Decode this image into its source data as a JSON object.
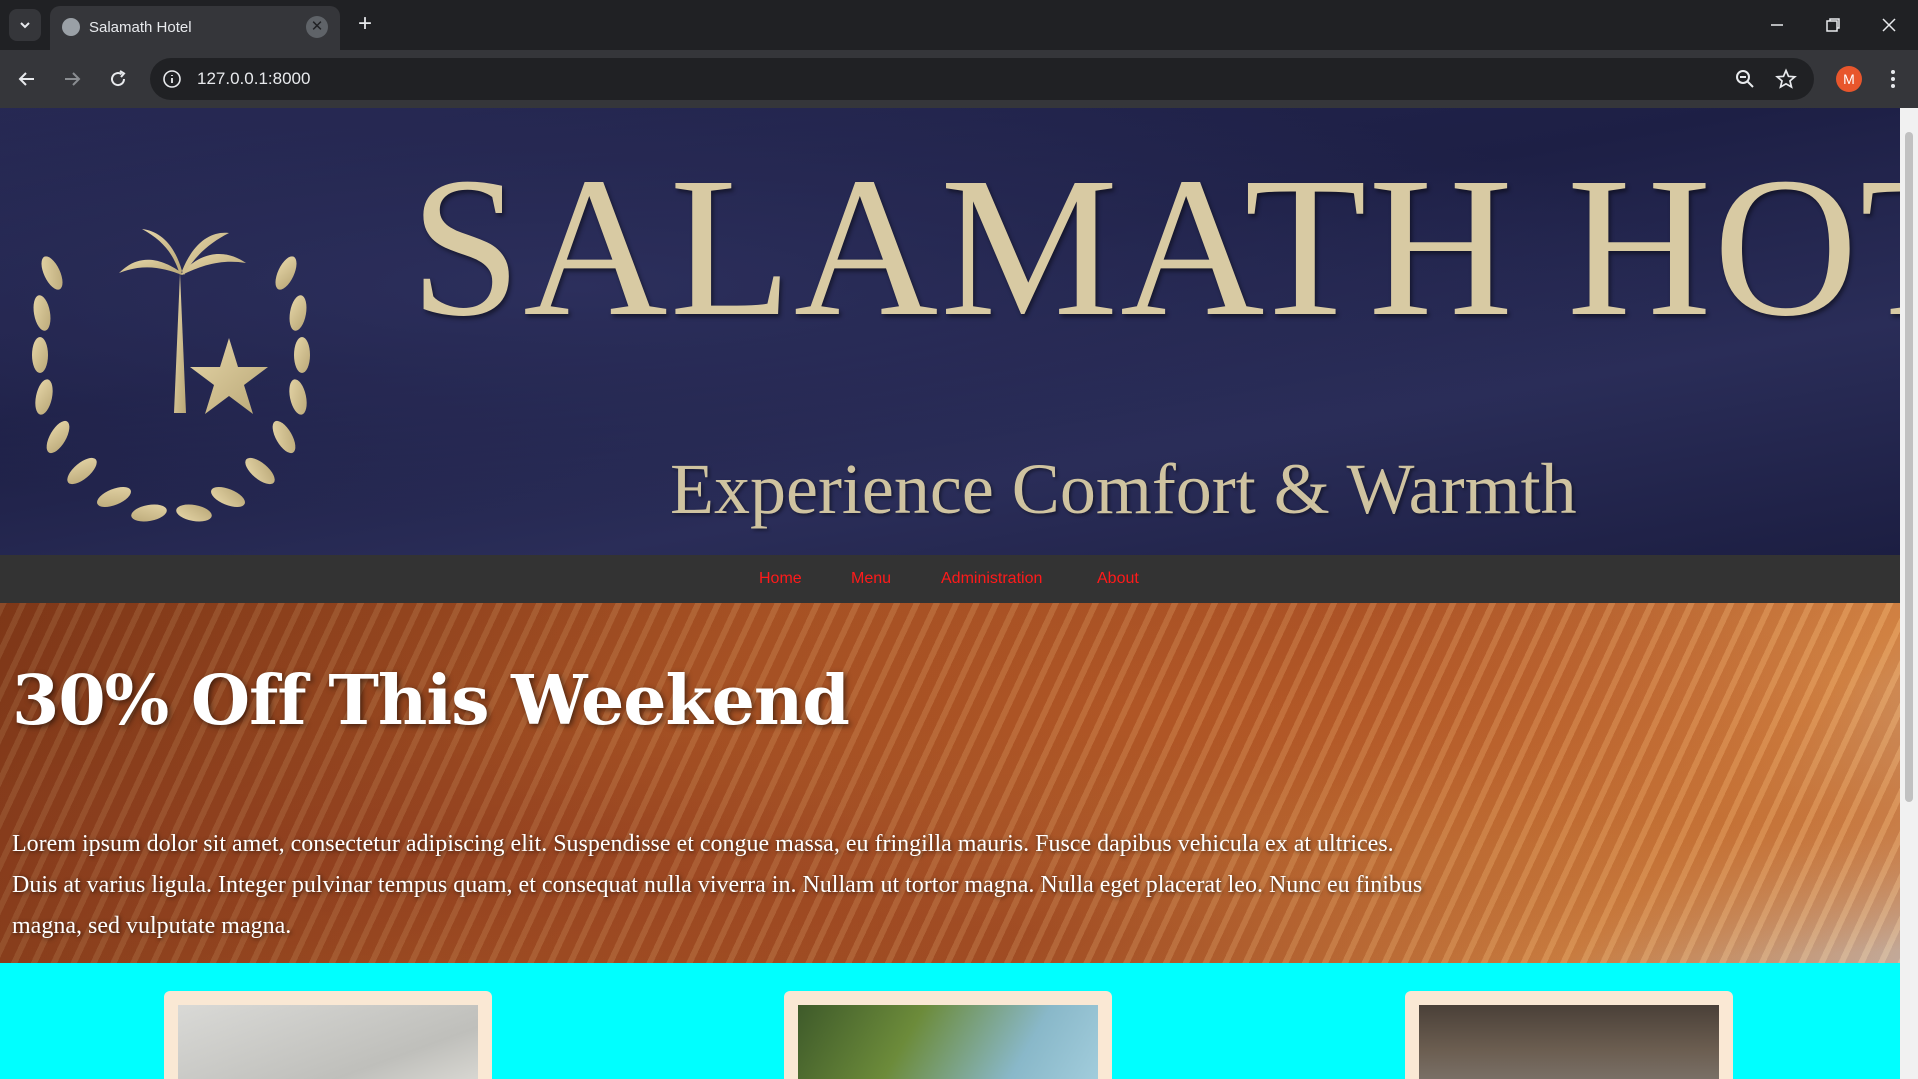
{
  "browser": {
    "tab_title": "Salamath Hotel",
    "url": "127.0.0.1:8000",
    "profile_initial": "M"
  },
  "banner": {
    "title": "SALAMATH HOTEL",
    "tagline": "Experience Comfort & Warmth",
    "colors": {
      "background": "#23254f",
      "gold": "#d8caa3"
    }
  },
  "nav": {
    "items": [
      {
        "label": "Home"
      },
      {
        "label": "Menu"
      },
      {
        "label": "Administration"
      },
      {
        "label": "About"
      }
    ],
    "link_color": "#ff1a1a",
    "background": "#333333"
  },
  "hero": {
    "title": "30% Off This Weekend",
    "text": "Lorem ipsum dolor sit amet, consectetur adipiscing elit. Suspendisse et congue massa, eu fringilla mauris. Fusce dapibus vehicula ex at ultrices. Duis at varius ligula. Integer pulvinar tempus quam, et consequat nulla viverra in. Nullam ut tortor magna. Nulla eget placerat leo. Nunc eu finibus magna, sed vulputate magna."
  },
  "cards": [
    {
      "image": "salad-bowl-image"
    },
    {
      "image": "vegetable-plate-image"
    },
    {
      "image": "chef-image"
    }
  ],
  "page_background": "#00ffff"
}
